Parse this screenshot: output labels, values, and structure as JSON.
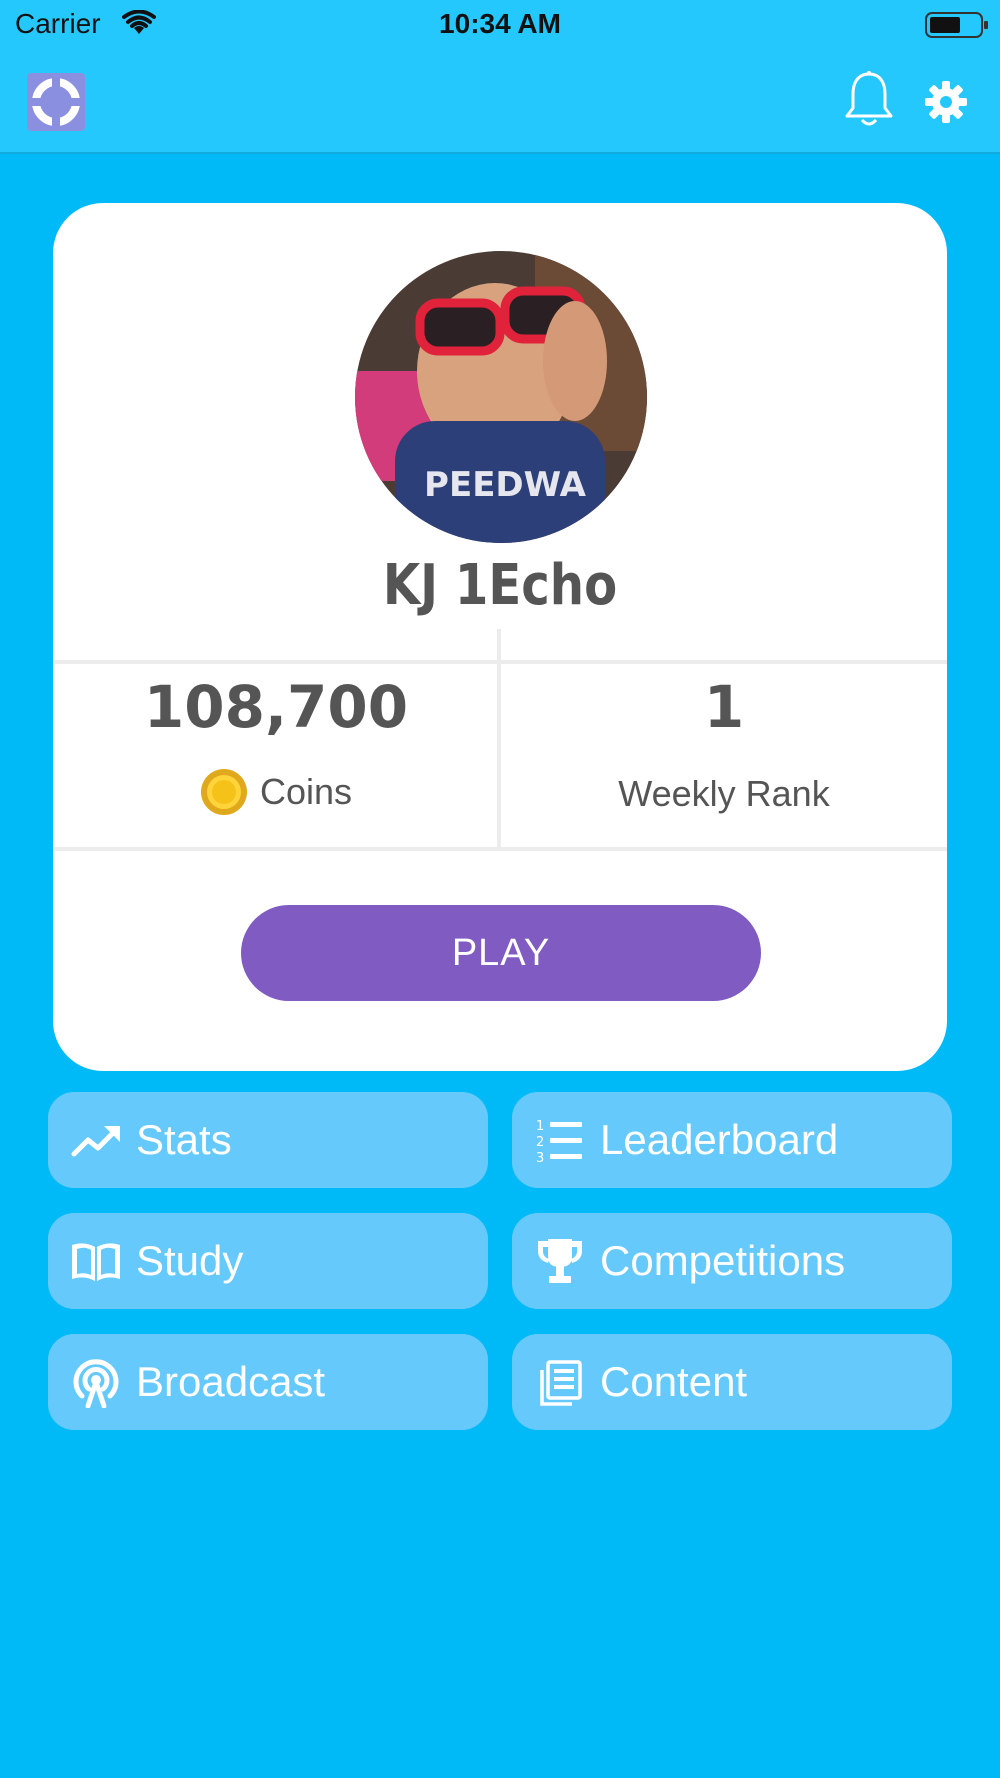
{
  "status_bar": {
    "carrier": "Carrier",
    "time": "10:34 AM"
  },
  "header": {
    "logo_icon": "crosshair-logo-icon",
    "notification_icon": "bell-icon",
    "settings_icon": "gear-icon"
  },
  "profile": {
    "username": "KJ 1Echo",
    "coins_value": "108,700",
    "coins_label": "Coins",
    "rank_value": "1",
    "rank_label": "Weekly Rank"
  },
  "actions": {
    "play_label": "PLAY"
  },
  "menu": [
    {
      "label": "Stats",
      "icon": "trending-up-icon"
    },
    {
      "label": "Leaderboard",
      "icon": "ordered-list-icon"
    },
    {
      "label": "Study",
      "icon": "open-book-icon"
    },
    {
      "label": "Competitions",
      "icon": "trophy-icon"
    },
    {
      "label": "Broadcast",
      "icon": "broadcast-icon"
    },
    {
      "label": "Content",
      "icon": "documents-icon"
    }
  ],
  "colors": {
    "background": "#00baf8",
    "header": "#25c8fc",
    "play_button": "#7f5bc2",
    "tile": "#66c9fb"
  }
}
